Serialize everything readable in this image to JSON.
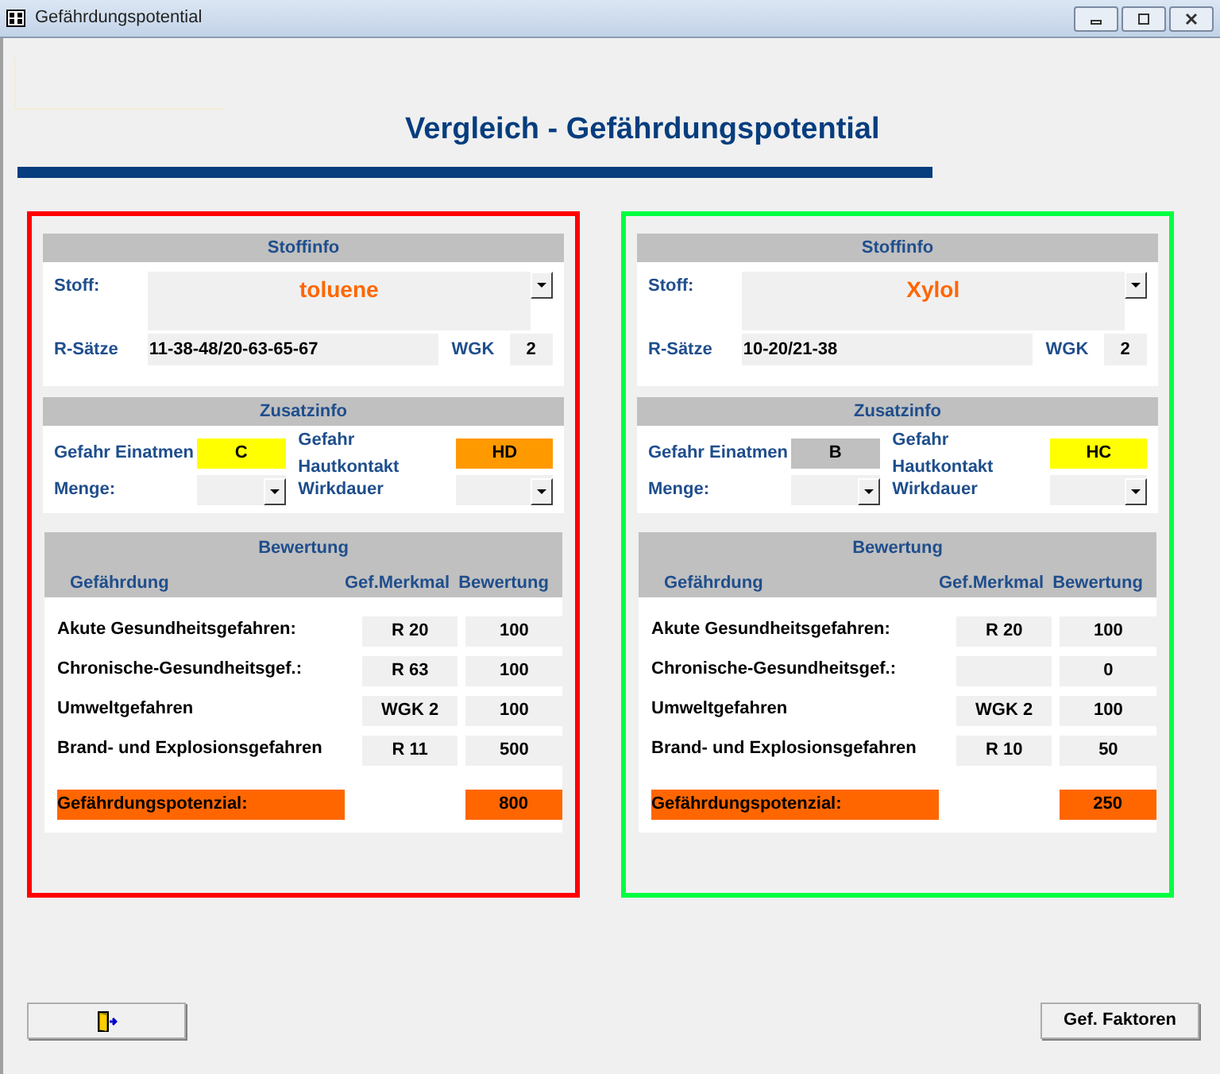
{
  "window": {
    "title": "Gefährdungspotential"
  },
  "heading": "Vergleich - Gefährdungspotential",
  "panels": [
    {
      "color": "#ff0000",
      "stoffinfo": {
        "title": "Stoffinfo",
        "stoff_label": "Stoff:",
        "stoff": "toluene",
        "r_saetze_label": "R-Sätze",
        "r_saetze": "11-38-48/20-63-65-67",
        "wgk_label": "WGK",
        "wgk": "2"
      },
      "zusatzinfo": {
        "title": "Zusatzinfo",
        "einatmen_label": "Gefahr Einatmen",
        "einatmen": {
          "value": "C",
          "color": "#ffff00"
        },
        "haut_label": "Gefahr Hautkontakt",
        "haut": {
          "value": "HD",
          "color": "#ff9900"
        },
        "menge_label": "Menge:",
        "wirkdauer_label": "Wirkdauer"
      },
      "bewertung": {
        "title": "Bewertung",
        "columns": [
          "Gefährdung",
          "Gef.Merkmal",
          "Bewertung"
        ],
        "rows": [
          {
            "label": "Akute Gesundheitsgefahren:",
            "merkmal": "R 20",
            "value": "100"
          },
          {
            "label": "Chronische-Gesundheitsgef.:",
            "merkmal": "R 63",
            "value": "100"
          },
          {
            "label": "Umweltgefahren",
            "merkmal": "WGK 2",
            "value": "100"
          },
          {
            "label": "Brand- und Explosionsgefahren",
            "merkmal": "R 11",
            "value": "500"
          }
        ],
        "total": {
          "label": "Gefährdungspotenzial:",
          "value": "800"
        }
      }
    },
    {
      "color": "#00ff40",
      "stoffinfo": {
        "title": "Stoffinfo",
        "stoff_label": "Stoff:",
        "stoff": "Xylol",
        "r_saetze_label": "R-Sätze",
        "r_saetze": "10-20/21-38",
        "wgk_label": "WGK",
        "wgk": "2"
      },
      "zusatzinfo": {
        "title": "Zusatzinfo",
        "einatmen_label": "Gefahr Einatmen",
        "einatmen": {
          "value": "B",
          "color": "#c0c0c0"
        },
        "haut_label": "Gefahr Hautkontakt",
        "haut": {
          "value": "HC",
          "color": "#ffff00"
        },
        "menge_label": "Menge:",
        "wirkdauer_label": "Wirkdauer"
      },
      "bewertung": {
        "title": "Bewertung",
        "columns": [
          "Gefährdung",
          "Gef.Merkmal",
          "Bewertung"
        ],
        "rows": [
          {
            "label": "Akute Gesundheitsgefahren:",
            "merkmal": "R 20",
            "value": "100"
          },
          {
            "label": "Chronische-Gesundheitsgef.:",
            "value": "0"
          },
          {
            "label": "Umweltgefahren",
            "merkmal": "WGK 2",
            "value": "100"
          },
          {
            "label": "Brand- und Explosionsgefahren",
            "merkmal": "R 10",
            "value": "50"
          }
        ],
        "total": {
          "label": "Gefährdungspotenzial:",
          "value": "250"
        }
      }
    }
  ],
  "buttons": [
    {
      "kind": "exit"
    },
    {
      "kind": "text",
      "label": "Gef. Faktoren"
    }
  ]
}
